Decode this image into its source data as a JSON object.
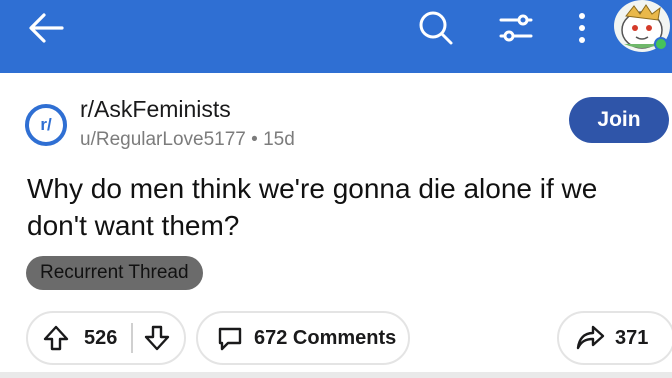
{
  "header": {
    "back_icon": "arrow-left-icon",
    "search_icon": "search-icon",
    "filter_icon": "filter-sliders-icon",
    "more_icon": "more-vertical-icon",
    "bar_color": "#2f6fd3"
  },
  "post": {
    "subreddit_badge": "r/",
    "subreddit": "r/AskFeminists",
    "author": "u/RegularLove5177",
    "separator": "•",
    "age": "15d",
    "join_label": "Join",
    "title": "Why do men think we're gonna die alone if we don't want them?",
    "flair": "Recurrent Thread"
  },
  "actions": {
    "score": "526",
    "comments": "672 Comments",
    "shares": "371"
  }
}
